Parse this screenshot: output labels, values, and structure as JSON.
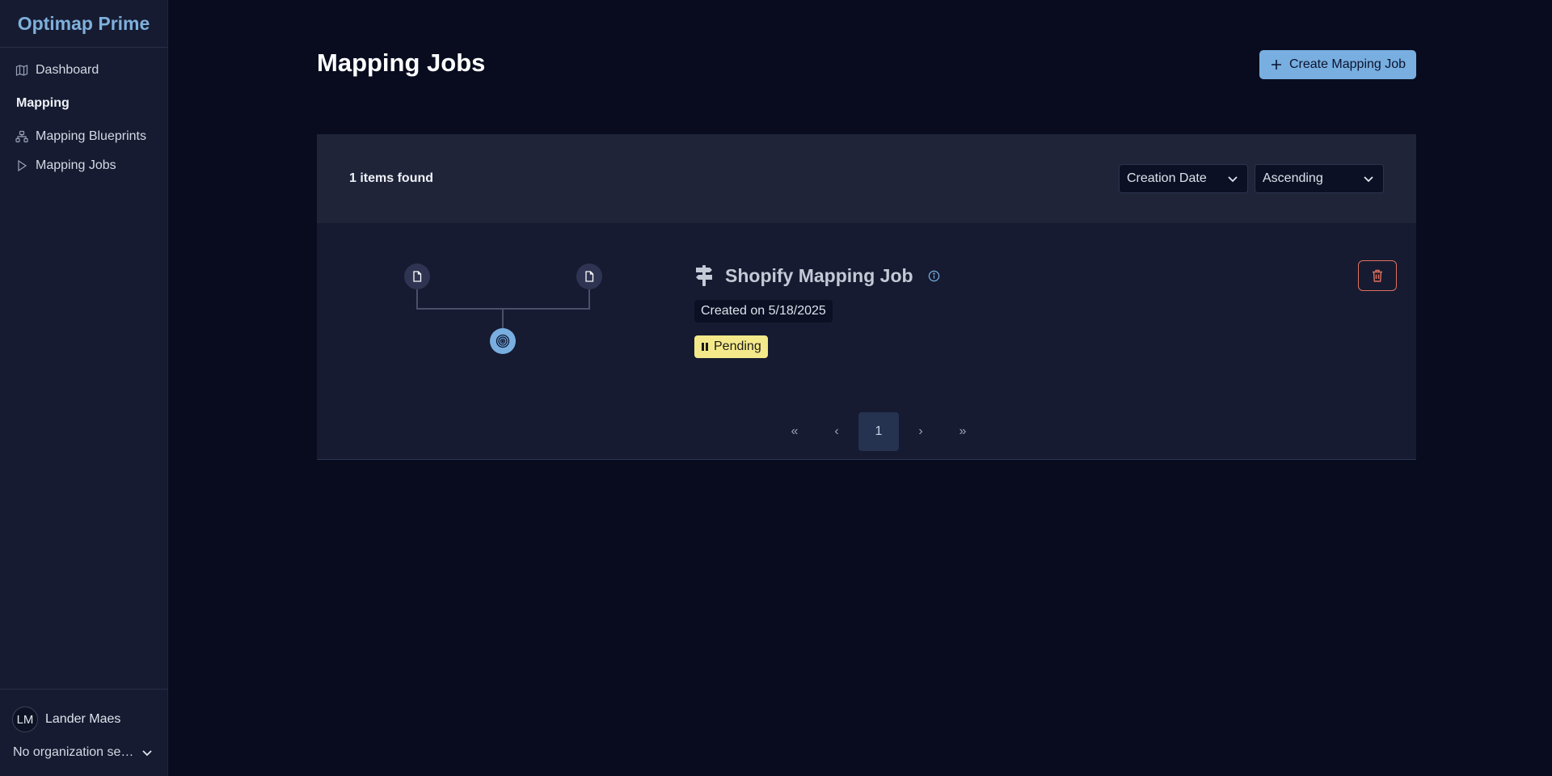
{
  "app": {
    "brand": "Optimap Prime"
  },
  "sidebar": {
    "items": [
      {
        "label": "Dashboard",
        "icon": "map-icon"
      },
      {
        "label": "Mapping Blueprints",
        "icon": "sitemap-icon"
      },
      {
        "label": "Mapping Jobs",
        "icon": "play-icon"
      }
    ],
    "section_mapping": "Mapping",
    "user": {
      "initials": "LM",
      "name": "Lander Maes"
    },
    "organization": "No organization selected"
  },
  "header": {
    "title": "Mapping Jobs",
    "create_label": "Create Mapping Job"
  },
  "list": {
    "items_found": "1 items found",
    "sort_field": "Creation Date",
    "sort_order": "Ascending",
    "jobs": [
      {
        "name": "Shopify Mapping Job",
        "created": "Created on 5/18/2025",
        "status": "Pending"
      }
    ]
  },
  "pagination": {
    "first": "«",
    "prev": "‹",
    "current": "1",
    "next": "›",
    "last": "»"
  },
  "colors": {
    "accent": "#78aee0",
    "background": "#080c1e",
    "sidebar": "#161b31",
    "pending": "#f4e98a",
    "danger": "#e0705e"
  }
}
